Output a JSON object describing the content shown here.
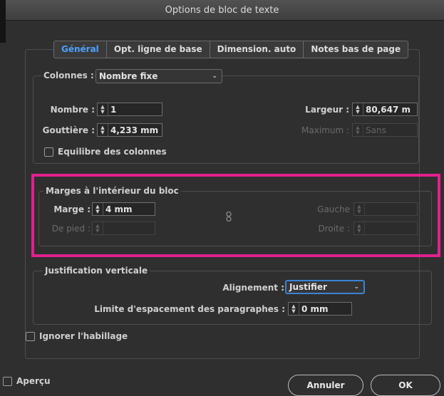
{
  "window": {
    "title": "Options de bloc de texte"
  },
  "tabs": [
    {
      "label": "Général",
      "active": true
    },
    {
      "label": "Opt. ligne de base",
      "active": false
    },
    {
      "label": "Dimension. auto",
      "active": false
    },
    {
      "label": "Notes bas de page",
      "active": false
    }
  ],
  "columns": {
    "label": "Colonnes :",
    "mode": "Nombre fixe",
    "number_label": "Nombre :",
    "number_value": "1",
    "gutter_label": "Gouttière :",
    "gutter_value": "4,233 mm",
    "width_label": "Largeur :",
    "width_value": "80,647 m",
    "max_label": "Maximum :",
    "max_value": "Sans",
    "balance_label": "Equilibre des colonnes",
    "balance_checked": false
  },
  "insets": {
    "title": "Marges à l'intérieur du bloc",
    "margin_label": "Marge :",
    "margin_value": "4 mm",
    "bottom_label": "De pied :",
    "left_label": "Gauche",
    "right_label": "Droite :"
  },
  "vertical": {
    "title": "Justification verticale",
    "align_label": "Alignement :",
    "align_value": "Justifier",
    "spacing_label": "Limite d'espacement des paragraphes :",
    "spacing_value": "0 mm"
  },
  "ignore_wrap": {
    "label": "Ignorer l'habillage",
    "checked": false
  },
  "footer": {
    "preview_label": "Aperçu",
    "preview_checked": false,
    "cancel_label": "Annuler",
    "ok_label": "OK"
  },
  "colors": {
    "accent": "#4ea1ff",
    "highlight": "#e3208e",
    "background": "#2f2f2f"
  }
}
